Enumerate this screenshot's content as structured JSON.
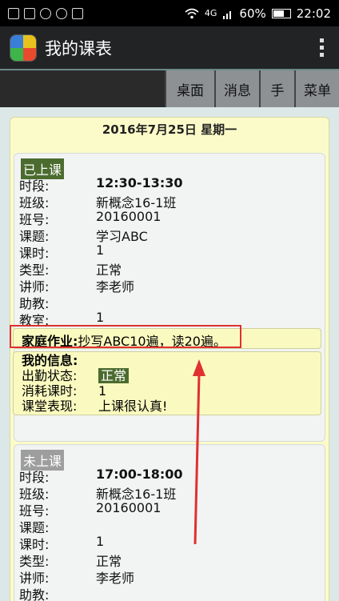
{
  "status_bar": {
    "network": "4G",
    "battery": "60%",
    "time": "22:02"
  },
  "app": {
    "title": "我的课表"
  },
  "toolbar": {
    "buttons": [
      {
        "label": "桌面"
      },
      {
        "label": "消息"
      },
      {
        "label": "手"
      },
      {
        "label": "菜单"
      }
    ]
  },
  "day": {
    "date": "2016年7月25日 星期一",
    "lessons": [
      {
        "status": "已上课",
        "time_label": "时段:",
        "time": "12:30-13:30",
        "class_label": "班级:",
        "class": "新概念16-1班",
        "class_no_label": "班号:",
        "class_no": "20160001",
        "topic_label": "课题:",
        "topic": "学习ABC",
        "hours_label": "课时:",
        "hours": "1",
        "type_label": "类型:",
        "type": "正常",
        "teacher_label": "讲师:",
        "teacher": "李老师",
        "assistant_label": "助教:",
        "assistant": "",
        "room_label": "教室:",
        "room": "1",
        "homework_label": "家庭作业:",
        "homework": "抄写ABC10遍，读20遍。",
        "my_info": {
          "title": "我的信息:",
          "attendance_label": "出勤状态:",
          "attendance": "正常",
          "hours_used_label": "消耗课时:",
          "hours_used": "1",
          "performance_label": "课堂表现:",
          "performance": "上课很认真!"
        }
      },
      {
        "status": "未上课",
        "time_label": "时段:",
        "time": "17:00-18:00",
        "class_label": "班级:",
        "class": "新概念16-1班",
        "class_no_label": "班号:",
        "class_no": "20160001",
        "topic_label": "课题:",
        "topic": "",
        "hours_label": "课时:",
        "hours": "1",
        "type_label": "类型:",
        "type": "正常",
        "teacher_label": "讲师:",
        "teacher": "李老师",
        "assistant_label": "助教:",
        "assistant": ""
      }
    ]
  },
  "colors": {
    "status_done": "#4b6b2f",
    "status_todo": "#9e9e9e",
    "card_bg": "#fbfbc9",
    "annotation": "#e03030"
  }
}
